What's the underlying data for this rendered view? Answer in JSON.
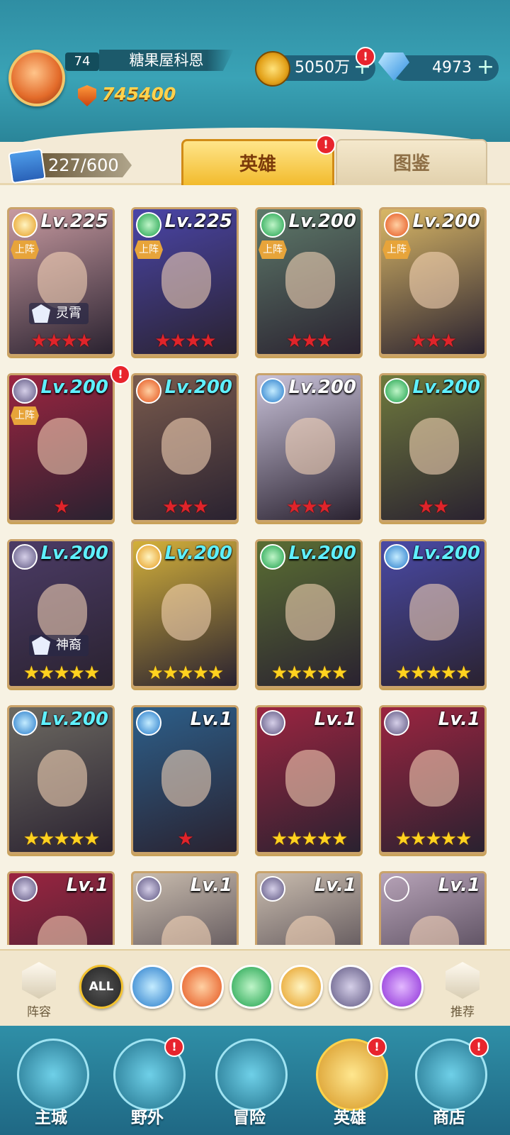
{
  "player": {
    "level": "74",
    "name": "糖果屋科恩",
    "power": "745400"
  },
  "resources": {
    "gold": "5050万",
    "gems": "4973",
    "plus": "+"
  },
  "hero_count": "227/600",
  "tabs": {
    "heroes": "英雄",
    "codex": "图鉴"
  },
  "notification_mark": "!",
  "heroes": [
    {
      "level": "Lv.225",
      "element": "light",
      "on_team": "上阵",
      "tag": "灵霄",
      "stars": "★★★★",
      "star_color": "red",
      "level_color": "white",
      "bg": "#c79aa0"
    },
    {
      "level": "Lv.225",
      "element": "wind",
      "on_team": "上阵",
      "tag": "",
      "stars": "★★★★",
      "star_color": "red",
      "level_color": "white",
      "bg": "#4a45a8"
    },
    {
      "level": "Lv.200",
      "element": "wind",
      "on_team": "上阵",
      "tag": "",
      "stars": "★★★",
      "star_color": "red",
      "level_color": "white",
      "bg": "#5e7a6a"
    },
    {
      "level": "Lv.200",
      "element": "fire",
      "on_team": "上阵",
      "tag": "",
      "stars": "★★★",
      "star_color": "red",
      "level_color": "white",
      "bg": "#d9b766"
    },
    {
      "level": "Lv.200",
      "element": "dark",
      "on_team": "上阵",
      "tag": "",
      "stars": "★",
      "star_color": "red",
      "level_color": "cyan",
      "bg": "#9b2440"
    },
    {
      "level": "Lv.200",
      "element": "fire",
      "on_team": "",
      "tag": "",
      "stars": "★★★",
      "star_color": "red",
      "level_color": "cyan",
      "bg": "#7a5b4d"
    },
    {
      "level": "Lv.200",
      "element": "water",
      "on_team": "",
      "tag": "",
      "stars": "★★★",
      "star_color": "red",
      "level_color": "white",
      "bg": "#c9c2d9"
    },
    {
      "level": "Lv.200",
      "element": "wind",
      "on_team": "",
      "tag": "",
      "stars": "★★",
      "star_color": "red",
      "level_color": "cyan",
      "bg": "#6f7a3d"
    },
    {
      "level": "Lv.200",
      "element": "dark",
      "on_team": "",
      "tag": "神裔",
      "stars": "★★★★★",
      "star_color": "gold",
      "level_color": "cyan",
      "bg": "#4c3c66"
    },
    {
      "level": "Lv.200",
      "element": "light",
      "on_team": "",
      "tag": "",
      "stars": "★★★★★",
      "star_color": "gold",
      "level_color": "cyan",
      "bg": "#d3b03a"
    },
    {
      "level": "Lv.200",
      "element": "wind",
      "on_team": "",
      "tag": "",
      "stars": "★★★★★",
      "star_color": "gold",
      "level_color": "cyan",
      "bg": "#5a6e33"
    },
    {
      "level": "Lv.200",
      "element": "water",
      "on_team": "",
      "tag": "",
      "stars": "★★★★★",
      "star_color": "gold",
      "level_color": "cyan",
      "bg": "#4a4aa6"
    },
    {
      "level": "Lv.200",
      "element": "water",
      "on_team": "",
      "tag": "",
      "stars": "★★★★★",
      "star_color": "gold",
      "level_color": "cyan",
      "bg": "#6d6a62"
    },
    {
      "level": "Lv.1",
      "element": "water",
      "on_team": "",
      "tag": "",
      "stars": "★",
      "star_color": "red",
      "level_color": "white",
      "bg": "#2c5f8a"
    },
    {
      "level": "Lv.1",
      "element": "dark",
      "on_team": "",
      "tag": "",
      "stars": "★★★★★",
      "star_color": "gold",
      "level_color": "white",
      "bg": "#9b2440"
    },
    {
      "level": "Lv.1",
      "element": "dark",
      "on_team": "",
      "tag": "",
      "stars": "★★★★★",
      "star_color": "gold",
      "level_color": "white",
      "bg": "#9b2440"
    },
    {
      "level": "Lv.1",
      "element": "dark",
      "on_team": "",
      "tag": "",
      "stars": "",
      "star_color": "gold",
      "level_color": "white",
      "bg": "#9b2440"
    },
    {
      "level": "Lv.1",
      "element": "dark",
      "on_team": "",
      "tag": "",
      "stars": "",
      "star_color": "gold",
      "level_color": "white",
      "bg": "#c9bcae"
    },
    {
      "level": "Lv.1",
      "element": "dark",
      "on_team": "",
      "tag": "",
      "stars": "",
      "star_color": "gold",
      "level_color": "white",
      "bg": "#c9bcae"
    },
    {
      "level": "Lv.1",
      "element": "purple",
      "on_team": "",
      "tag": "",
      "stars": "",
      "star_color": "gold",
      "level_color": "white",
      "bg": "#b7a3b8"
    }
  ],
  "filters": {
    "all_label": "ALL",
    "lineup": "阵容",
    "recommend": "推荐"
  },
  "nav": {
    "city": "主城",
    "wild": "野外",
    "adventure": "冒险",
    "heroes": "英雄",
    "shop": "商店"
  },
  "icons": {
    "elements": [
      "water-element-icon",
      "fire-element-icon",
      "wind-element-icon",
      "light-element-icon",
      "dark-element-icon",
      "arcane-element-icon"
    ]
  }
}
